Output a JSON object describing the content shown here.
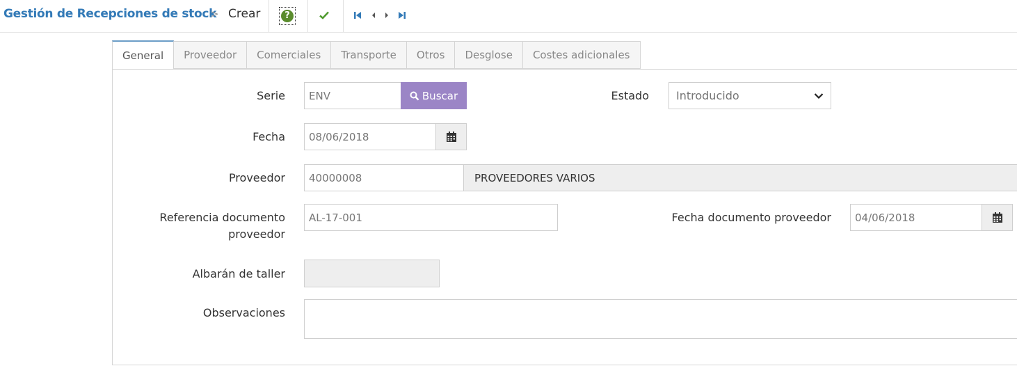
{
  "header": {
    "title": "Gestión de Recepciones de stock",
    "separator": ">",
    "current": "Crear",
    "help_glyph": "?"
  },
  "icons": {
    "help": "help-icon",
    "save": "check-icon",
    "first": "first-record-icon",
    "prev": "prev-record-icon",
    "next": "next-record-icon",
    "last": "last-record-icon",
    "search": "search-icon",
    "calendar": "calendar-icon",
    "dropdown": "chevron-down-icon"
  },
  "tabs": [
    {
      "label": "General",
      "active": true
    },
    {
      "label": "Proveedor"
    },
    {
      "label": "Comerciales"
    },
    {
      "label": "Transporte"
    },
    {
      "label": "Otros"
    },
    {
      "label": "Desglose"
    },
    {
      "label": "Costes adicionales"
    }
  ],
  "form": {
    "serie": {
      "label": "Serie",
      "value": "ENV"
    },
    "buscar_label": "Buscar",
    "estado": {
      "label": "Estado",
      "value": "Introducido"
    },
    "fecha": {
      "label": "Fecha",
      "value": "08/06/2018"
    },
    "proveedor": {
      "label": "Proveedor",
      "code": "40000008",
      "name": "PROVEEDORES VARIOS"
    },
    "referencia": {
      "label_line1": "Referencia documento",
      "label_line2": "proveedor",
      "value": "AL-17-001"
    },
    "fecha_doc_proveedor": {
      "label": "Fecha documento proveedor",
      "value": "04/06/2018"
    },
    "albaran_taller": {
      "label": "Albarán de taller",
      "value": ""
    },
    "observaciones": {
      "label": "Observaciones",
      "value": ""
    }
  },
  "colors": {
    "link": "#337ab7",
    "buscar_button": "#9b85c6",
    "help_green": "#5a8c2d",
    "save_green": "#4f9a2e",
    "active_tab_border": "#6c9dc7"
  }
}
